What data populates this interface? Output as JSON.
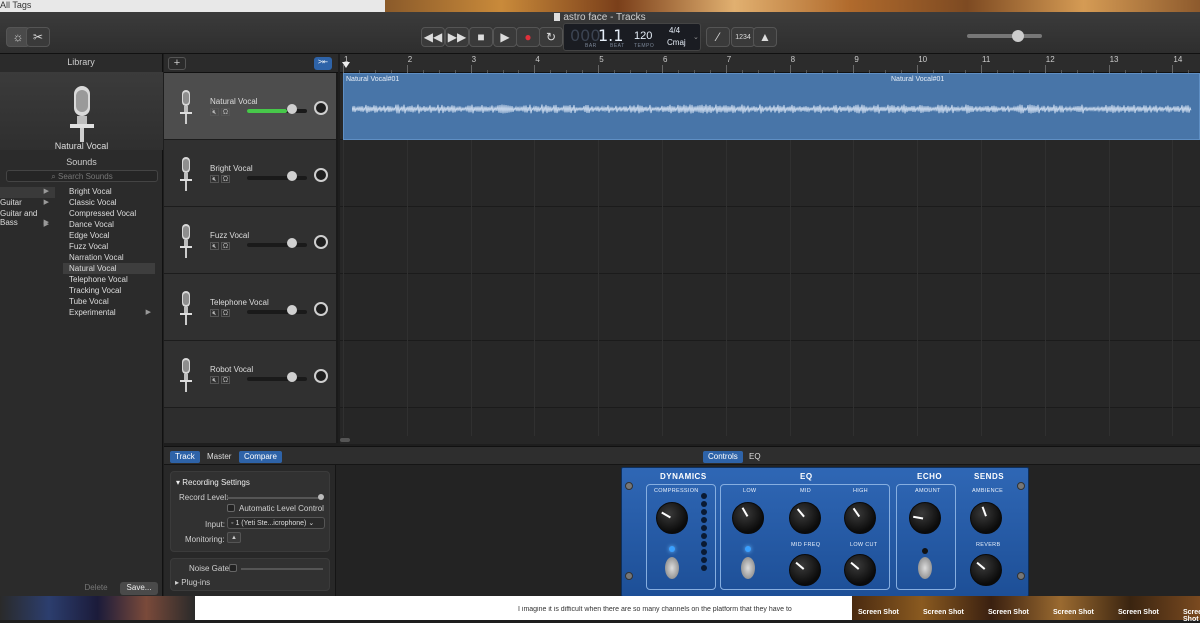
{
  "desktop": {
    "top_left_tag": "All Tags"
  },
  "window": {
    "title": "astro face - Tracks"
  },
  "lcd": {
    "bar_beat": "1.1",
    "bar_label": "BAR",
    "beat_label": "BEAT",
    "tempo": "120",
    "tempo_label": "TEMPO",
    "time_sig": "4/4",
    "key": "Cmaj"
  },
  "count_in_label": "1234",
  "library": {
    "header": "Library",
    "preset_name": "Natural Vocal",
    "sounds_header": "Sounds",
    "search_placeholder": "Search Sounds",
    "categories": [
      "",
      "Guitar",
      "Guitar and Bass",
      ""
    ],
    "presets": [
      "Bright Vocal",
      "Classic Vocal",
      "Compressed Vocal",
      "Dance Vocal",
      "Edge Vocal",
      "Fuzz Vocal",
      "Narration Vocal",
      "Natural Vocal",
      "Telephone Vocal",
      "Tracking Vocal",
      "Tube Vocal",
      "Experimental"
    ],
    "selected_index": 7,
    "delete_label": "Delete",
    "save_label": "Save..."
  },
  "tracks": [
    {
      "name": "Natural Vocal",
      "volume": 0.75,
      "selected": true
    },
    {
      "name": "Bright Vocal",
      "volume": 0.75,
      "selected": false
    },
    {
      "name": "Fuzz Vocal",
      "volume": 0.75,
      "selected": false
    },
    {
      "name": "Telephone Vocal",
      "volume": 0.75,
      "selected": false
    },
    {
      "name": "Robot Vocal",
      "volume": 0.75,
      "selected": false
    }
  ],
  "ruler": [
    "1",
    "2",
    "3",
    "4",
    "5",
    "6",
    "7",
    "8",
    "9",
    "10",
    "11",
    "12",
    "13",
    "14"
  ],
  "region": {
    "label_a": "Natural Vocal#01",
    "label_b": "Natural Vocal#01",
    "color": "#4875a8"
  },
  "editor": {
    "tabs": {
      "track": "Track",
      "master": "Master",
      "compare": "Compare",
      "controls": "Controls",
      "eq": "EQ"
    },
    "recording_settings": "Recording Settings",
    "record_level": "Record Level:",
    "auto_level": "Automatic Level Control",
    "input_label": "Input:",
    "input_value": "1 (Yeti Ste...icrophone)",
    "monitoring_label": "Monitoring:",
    "noise_gate": "Noise Gate:",
    "plugins": "Plug-ins"
  },
  "plugin": {
    "dynamics": "DYNAMICS",
    "eq": "EQ",
    "echo": "ECHO",
    "sends": "SENDS",
    "compression": "COMPRESSION",
    "low": "LOW",
    "mid": "MID",
    "high": "HIGH",
    "mid_freq": "MID FREQ",
    "low_cut": "LOW CUT",
    "amount": "AMOUNT",
    "ambience": "AMBIENCE",
    "reverb": "REVERB"
  },
  "bottom_strip": {
    "text": "I imagine it is difficult when there are so many channels on the platform that they have to",
    "shots": [
      "Screen Shot",
      "Screen Shot",
      "Screen Shot",
      "Screen Shot",
      "Screen Shot",
      "Screen Shot"
    ]
  },
  "colors": {
    "accent": "#2e63a8",
    "region": "#4875a8",
    "record": "#e0303a",
    "meter": "#47c84a"
  }
}
